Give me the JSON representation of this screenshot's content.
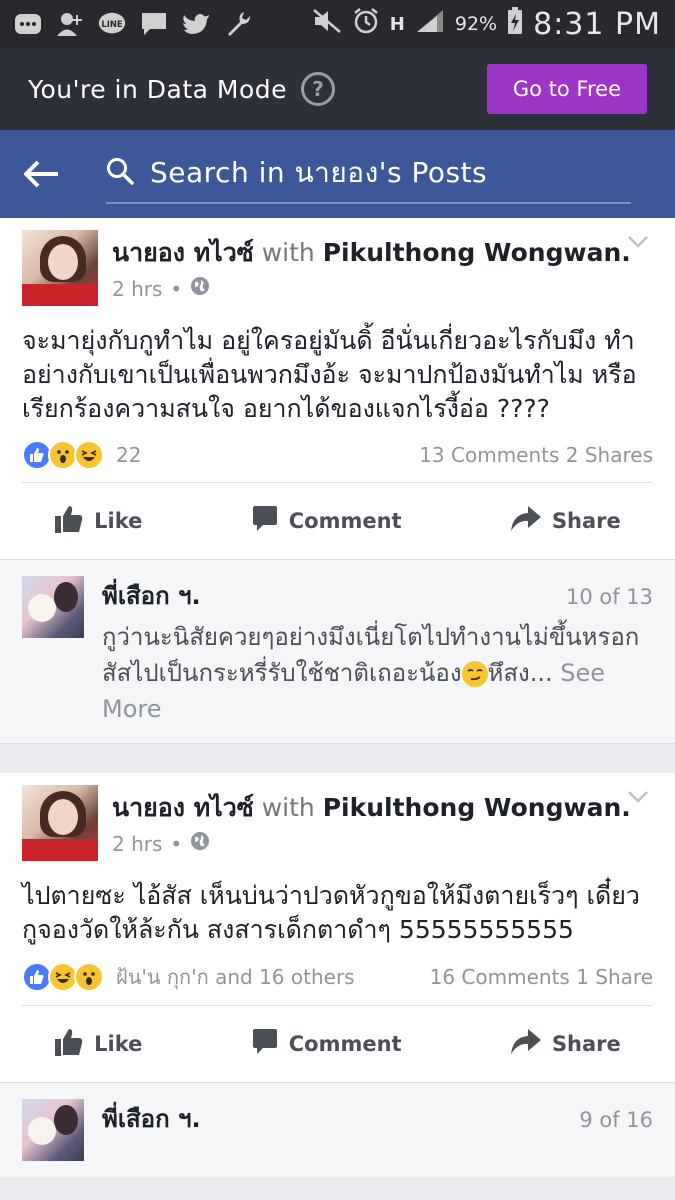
{
  "status_bar": {
    "battery": "92%",
    "time": "8:31 PM",
    "network": "H"
  },
  "data_mode": {
    "text": "You're in Data Mode",
    "help": "?",
    "button": "Go to Free"
  },
  "search": {
    "text": "Search in นายอง's Posts"
  },
  "actions": {
    "like": "Like",
    "comment": "Comment",
    "share": "Share"
  },
  "posts": [
    {
      "author": "นายอง ทไวซ์",
      "with_word": "with",
      "tagged": "Pikulthong Wongwan.",
      "time": "2 hrs",
      "body": "จะมายุ่งกับกูทำไม อยู่ใครอยู่มันดิ้ อีนั่นเกี่ยวอะไรกับมึง ทำอย่างกับเขาเป็นเพื่อนพวกมึงอ้ะ จะมาปกป้องมันทำไม หรือเรียกร้องความสนใจ อยากได้ของแจกไรงี้อ่อ ????",
      "reaction_count": "22",
      "counts": "13 Comments 2 Shares",
      "comment": {
        "name": "พี่เสือก ฯ.",
        "position": "10 of 13",
        "text_before": "กูว่านะนิสัยควยๆอย่างมึงเนี่ยโตไปทำงานไม่ขึ้นหรอกสัสไปเป็นกระหรี่รับใช้ชาติเถอะน้อง",
        "text_after": "หึสง...",
        "see_more": "See More"
      }
    },
    {
      "author": "นายอง ทไวซ์",
      "with_word": "with",
      "tagged": "Pikulthong Wongwan.",
      "time": "2 hrs",
      "body": "ไปตายซะ ไอ้สัส เห็นบ่นว่าปวดหัวกูขอให้มึงตายเร็วๆ เดี๋ยวกูจองวัดให้ล้ะกัน สงสารเด็กตาดำๆ 55555555555",
      "reaction_count": "ฝ้น'น กุก'ก and 16 others",
      "counts": "16 Comments 1 Share",
      "comment": {
        "name": "พี่เสือก ฯ.",
        "position": "9 of 16"
      }
    }
  ]
}
